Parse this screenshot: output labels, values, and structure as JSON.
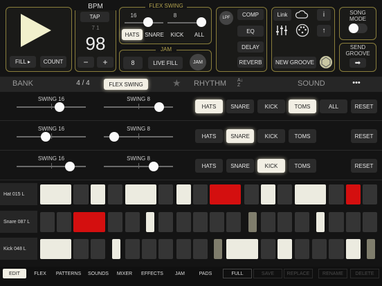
{
  "transport": {
    "fill_label": "FILL ▸",
    "count_label": "COUNT"
  },
  "bpm": {
    "title": "BPM",
    "tap_label": "TAP",
    "fraction": "7 1",
    "value": "98",
    "minus": "−",
    "plus": "+"
  },
  "flex_swing": {
    "title": "FLEX SWING",
    "val_left": "16",
    "val_right": "8",
    "buttons": [
      "HATS",
      "SNARE",
      "KICK",
      "ALL"
    ]
  },
  "jam": {
    "title": "JAM",
    "value": "8",
    "live_fill": "LIVE FILL",
    "jam_label": "JAM"
  },
  "fx": {
    "lpf": "LPF",
    "comp": "COMP",
    "eq": "EQ",
    "delay": "DELAY",
    "reverb": "REVERB"
  },
  "link": {
    "link_label": "Link",
    "new_groove": "NEW GROOVE"
  },
  "song_mode": {
    "label": "SONG\nMODE"
  },
  "send_groove": {
    "label": "SEND\nGROOVE"
  },
  "nav": {
    "bank": "BANK",
    "signature": "4 / 4",
    "flex_swing": "FLEX SWING",
    "rhythm": "RHYTHM",
    "sound": "SOUND",
    "more": "•••"
  },
  "swing_rows": [
    {
      "left_label": "SWING 16",
      "right_label": "SWING 8",
      "left_pos": 0.62,
      "right_pos": 0.8,
      "buttons": [
        "HATS",
        "SNARE",
        "KICK",
        "TOMS",
        "ALL"
      ],
      "lit": [
        0,
        3
      ],
      "reset": "RESET"
    },
    {
      "left_label": "SWING 16",
      "right_label": "SWING 8",
      "left_pos": 0.42,
      "right_pos": 0.15,
      "buttons": [
        "HATS",
        "SNARE",
        "KICK",
        "TOMS"
      ],
      "lit": [
        1
      ],
      "reset": "RESET"
    },
    {
      "left_label": "SWING 16",
      "right_label": "SWING 8",
      "left_pos": 0.77,
      "right_pos": 0.72,
      "buttons": [
        "HATS",
        "SNARE",
        "KICK",
        "TOMS"
      ],
      "lit": [
        2
      ],
      "reset": "RESET"
    }
  ],
  "tracks": [
    {
      "name": "Hat 015 L"
    },
    {
      "name": "Snare 087 L"
    },
    {
      "name": "Kick 048 L"
    }
  ],
  "tabs": [
    "EDIT",
    "FLEX",
    "PATTERNS",
    "SOUNDS",
    "MIXER",
    "EFFECTS",
    "JAM",
    "PADS"
  ],
  "actions": [
    "FULL",
    "SAVE",
    "REPLACE",
    "RENAME",
    "DELETE"
  ]
}
